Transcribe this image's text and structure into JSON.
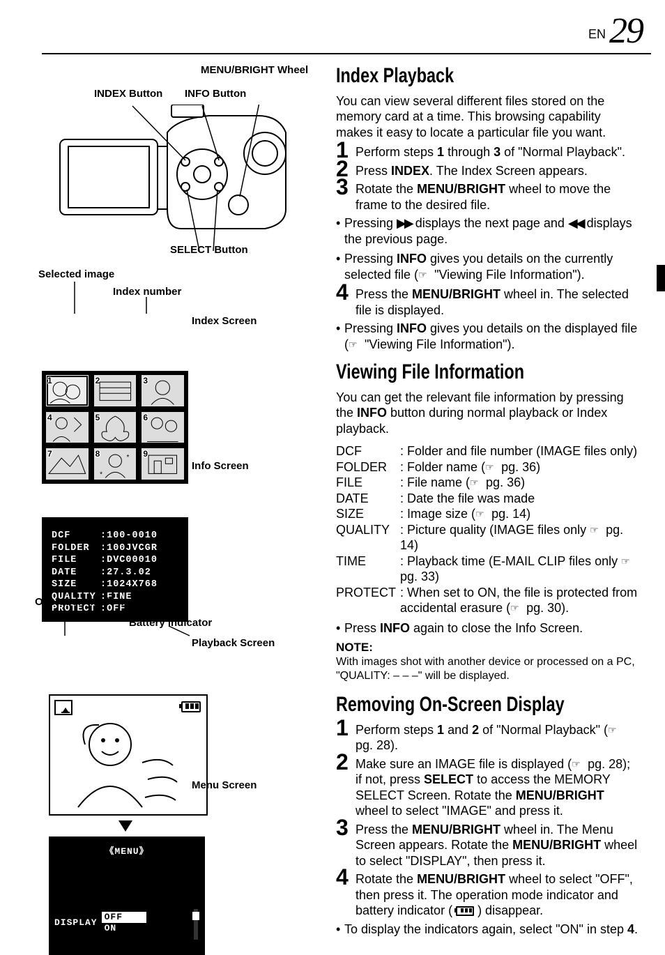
{
  "header": {
    "lang": "EN",
    "page": "29"
  },
  "left": {
    "labels": {
      "menu_bright": "MENU/BRIGHT Wheel",
      "index_btn": "INDEX Button",
      "info_btn": "INFO Button",
      "select_btn": "SELECT Button",
      "selected_image": "Selected image",
      "index_number": "Index number",
      "index_screen": "Index Screen",
      "info_screen": "Info Screen",
      "op_mode": "Operation mode indicator",
      "battery": "Battery indicator",
      "playback_screen": "Playback Screen",
      "menu_screen": "Menu Screen"
    },
    "thumbs": [
      "1",
      "2",
      "3",
      "4",
      "5",
      "6",
      "7",
      "8",
      "9"
    ],
    "info": {
      "DCF": "100-0010",
      "FOLDER": "100JVCGR",
      "FILE": "DVC00010",
      "DATE": "27.3.02",
      "SIZE": "1024X768",
      "QUALITY": "FINE",
      "PROTECT": "OFF"
    },
    "menu": {
      "title": "MENU",
      "item": "DISPLAY",
      "off": "OFF",
      "on": "ON"
    }
  },
  "right": {
    "s1": {
      "h": "Index Playback",
      "intro": "You can view several different files stored on the memory card at a time. This browsing capability makes it easy to locate a particular file you want.",
      "st1a": "Perform steps ",
      "st1b": "1",
      "st1c": " through ",
      "st1d": "3",
      "st1e": " of \"Normal Playback\".",
      "st2a": "Press ",
      "st2b": "INDEX",
      "st2c": ". The Index Screen appears.",
      "st3a": "Rotate the ",
      "st3b": "MENU/BRIGHT",
      "st3c": " wheel to move the frame to the desired file.",
      "b1a": "Pressing ",
      "b1b": " displays the next page and ",
      "b1c": " displays the previous page.",
      "b2a": "Pressing ",
      "b2b": "INFO",
      "b2c": " gives you details on the currently selected file (",
      "b2d": " \"Viewing File Information\").",
      "st4a": "Press the ",
      "st4b": "MENU/BRIGHT",
      "st4c": " wheel in. The selected file is displayed.",
      "b3a": "Pressing ",
      "b3b": "INFO",
      "b3c": " gives you details on the displayed file (",
      "b3d": " \"Viewing File Information\")."
    },
    "s2": {
      "h": "Viewing File Information",
      "intro_a": "You can get the relevant file information by pressing the ",
      "intro_b": "INFO",
      "intro_c": " button during normal playback or Index playback.",
      "defs": {
        "DCF": "Folder and file number (IMAGE files only)",
        "FOLDER_a": "Folder name (",
        "FOLDER_b": " pg. 36)",
        "FILE_a": "File name (",
        "FILE_b": " pg. 36)",
        "DATE": "Date the file was made",
        "SIZE_a": "Image size (",
        "SIZE_b": " pg. 14)",
        "QUALITY_a": "Picture quality (IMAGE files only ",
        "QUALITY_b": " pg. 14)",
        "TIME_a": "Playback time (E-MAIL CLIP files only ",
        "TIME_b": " pg. 33)",
        "PROTECT_a": "When set to ON, the file is protected from accidental erasure (",
        "PROTECT_b": " pg. 30)."
      },
      "close_a": "Press ",
      "close_b": "INFO",
      "close_c": " again to close the Info Screen.",
      "note_h": "NOTE:",
      "note": "With images shot with another device or processed on a PC, \"QUALITY: – – –\" will be displayed."
    },
    "s3": {
      "h": "Removing On-Screen Display",
      "st1a": "Perform steps ",
      "st1b": "1",
      "st1c": " and ",
      "st1d": "2",
      "st1e": " of \"Normal Playback\" (",
      "st1f": " pg. 28).",
      "st2a": "Make sure an IMAGE file is displayed (",
      "st2b": " pg. 28); if not, press ",
      "st2c": "SELECT",
      "st2d": " to access the MEMORY SELECT Screen. Rotate the ",
      "st2e": "MENU/BRIGHT",
      "st2f": " wheel to select \"IMAGE\" and press it.",
      "st3a": "Press the ",
      "st3b": "MENU/BRIGHT",
      "st3c": " wheel in. The Menu Screen appears. Rotate the ",
      "st3d": "MENU/BRIGHT",
      "st3e": " wheel to select \"DISPLAY\", then press it.",
      "st4a": "Rotate the ",
      "st4b": "MENU/BRIGHT",
      "st4c": " wheel to select \"OFF\", then press it. The operation mode indicator and battery indicator ( ",
      "st4d": " ) disappear.",
      "b1a": "To display the indicators again, select \"ON\" in step ",
      "b1b": "4",
      "b1c": "."
    }
  }
}
